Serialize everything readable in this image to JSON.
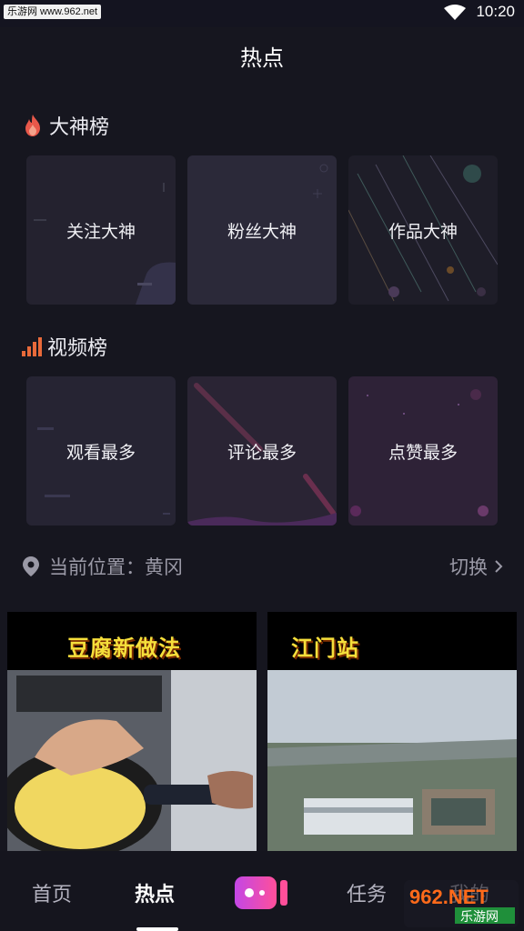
{
  "status_bar": {
    "watermark": "乐游网 www.962.net",
    "time": "10:20",
    "wifi_icon": "wifi-icon"
  },
  "header": {
    "title": "热点"
  },
  "gods_section": {
    "title": "大神榜",
    "icon": "fire-icon",
    "cards": [
      {
        "label": "关注大神"
      },
      {
        "label": "粉丝大神"
      },
      {
        "label": "作品大神"
      }
    ]
  },
  "video_section": {
    "title": "视频榜",
    "icon": "bar-chart-icon",
    "cards": [
      {
        "label": "观看最多"
      },
      {
        "label": "评论最多"
      },
      {
        "label": "点赞最多"
      }
    ]
  },
  "location": {
    "label": "当前位置：黄冈",
    "switch_label": "切换"
  },
  "videos": [
    {
      "caption": "豆腐新做法"
    },
    {
      "caption": "江门站"
    }
  ],
  "bottom_nav": {
    "items": [
      {
        "label": "首页"
      },
      {
        "label": "热点"
      },
      {
        "label": "任务"
      },
      {
        "label": "我的"
      }
    ],
    "active_index": 1
  },
  "watermark_logo": {
    "primary": "962.NET",
    "secondary": "乐游网"
  },
  "colors": {
    "accent": "#e96a3a",
    "background": "#16161f",
    "card": "#262433"
  }
}
